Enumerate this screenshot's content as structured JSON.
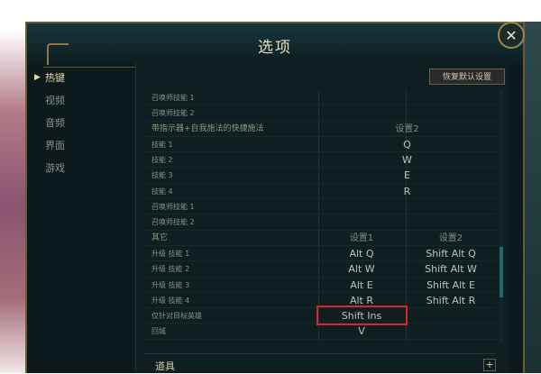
{
  "window": {
    "title": "选项",
    "close_glyph": "✕"
  },
  "sidebar": {
    "items": [
      {
        "label": "热键",
        "active": true
      },
      {
        "label": "视频",
        "active": false
      },
      {
        "label": "音频",
        "active": false
      },
      {
        "label": "界面",
        "active": false
      },
      {
        "label": "游戏",
        "active": false
      }
    ],
    "active_marker": "▶"
  },
  "toolbar": {
    "reset_label": "恢复默认设置"
  },
  "rows": [
    {
      "name": "召唤师技能 1",
      "c1": "",
      "c2": ""
    },
    {
      "name": "召唤师技能 2",
      "c1": "",
      "c2": ""
    },
    {
      "name": "带指示器+自我施法的快捷施法",
      "span": "设置2",
      "section": true
    },
    {
      "name": "技能 1",
      "span": "Q"
    },
    {
      "name": "技能 2",
      "span": "W"
    },
    {
      "name": "技能 3",
      "span": "E"
    },
    {
      "name": "技能 4",
      "span": "R"
    },
    {
      "name": "召唤师技能 1",
      "span": ""
    },
    {
      "name": "召唤师技能 2",
      "span": ""
    },
    {
      "name": "其它",
      "c1": "设置1",
      "c2": "设置2",
      "section": true
    },
    {
      "name": "升级 技能 1",
      "c1": "Alt  Q",
      "c2": "Shift  Alt  Q"
    },
    {
      "name": "升级 技能 2",
      "c1": "Alt  W",
      "c2": "Shift  Alt  W"
    },
    {
      "name": "升级 技能 3",
      "c1": "Alt  E",
      "c2": "Shift  Alt  E"
    },
    {
      "name": "升级 技能 4",
      "c1": "Alt  R",
      "c2": "Shift  Alt  R"
    },
    {
      "name": "仅针对目标英雄",
      "c1": "Shift  Ins",
      "c2": ""
    },
    {
      "name": "回城",
      "c1": "V",
      "c2": ""
    }
  ],
  "footer_section": {
    "label": "道具",
    "expand_glyph": "+"
  },
  "colors": {
    "highlight": "#d9262a",
    "gold": "#6b5b32"
  }
}
